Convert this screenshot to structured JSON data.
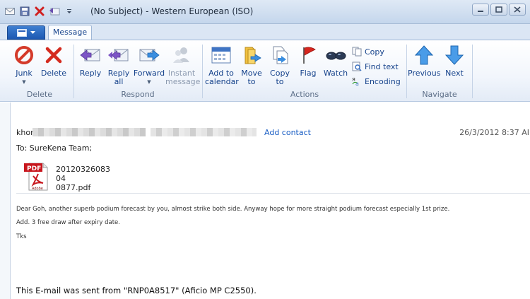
{
  "window": {
    "title": "(No Subject) - Western European (ISO)"
  },
  "tabs": {
    "message": "Message"
  },
  "ribbon": {
    "delete_group": {
      "label": "Delete",
      "junk": "Junk",
      "delete": "Delete"
    },
    "respond_group": {
      "label": "Respond",
      "reply": "Reply",
      "reply_all_1": "Reply",
      "reply_all_2": "all",
      "forward": "Forward",
      "instant_1": "Instant",
      "instant_2": "message"
    },
    "actions_group": {
      "label": "Actions",
      "add_calendar_1": "Add to",
      "add_calendar_2": "calendar",
      "move_1": "Move",
      "move_2": "to",
      "copy_1": "Copy",
      "copy_2": "to",
      "flag": "Flag",
      "watch": "Watch",
      "copy_small": "Copy",
      "find_text": "Find text",
      "encoding": "Encoding"
    },
    "navigate_group": {
      "label": "Navigate",
      "previous": "Previous",
      "next": "Next"
    }
  },
  "message": {
    "from_prefix": "khor",
    "add_contact": "Add contact",
    "date": "26/3/2012 8:37 AI",
    "to": "To: SureKena Team;",
    "attachment_line1": "2012032608304",
    "attachment_line2": "0877.pdf",
    "pdf_badge": "PDF",
    "adobe_label": "Adobe",
    "body_1": "Dear Goh, another superb podium forecast by you, almost strike both side. Anyway hope for more straight podium forecast especially 1st prize.",
    "body_2": "Add. 3 free draw after expiry date.",
    "body_3": "Tks",
    "footer": "This E-mail was sent from \"RNP0A8517\" (Aficio MP C2550)."
  },
  "colors": {
    "accent": "#15428b",
    "link": "#1a5ec4",
    "ribbon_bg": "#f2f6fc"
  }
}
